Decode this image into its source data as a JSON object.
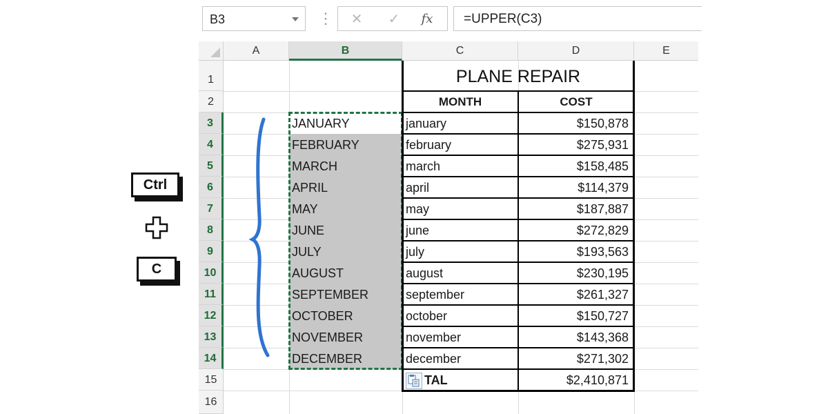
{
  "formula_bar": {
    "name_box": "B3",
    "fx_label": "fx",
    "cancel_icon": "x-icon",
    "enter_icon": "check-icon",
    "formula": "=UPPER(C3)"
  },
  "columns": [
    "A",
    "B",
    "C",
    "D",
    "E"
  ],
  "selected_column": "B",
  "rows": [
    "1",
    "2",
    "3",
    "4",
    "5",
    "6",
    "7",
    "8",
    "9",
    "10",
    "11",
    "12",
    "13",
    "14",
    "15",
    "16"
  ],
  "table": {
    "title": "PLANE REPAIR",
    "header_month": "MONTH",
    "header_cost": "COST",
    "upper_months": [
      "JANUARY",
      "FEBRUARY",
      "MARCH",
      "APRIL",
      "MAY",
      "JUNE",
      "JULY",
      "AUGUST",
      "SEPTEMBER",
      "OCTOBER",
      "NOVEMBER",
      "DECEMBER"
    ],
    "months": [
      "january",
      "february",
      "march",
      "april",
      "may",
      "june",
      "july",
      "august",
      "september",
      "october",
      "november",
      "december"
    ],
    "costs": [
      "$150,878",
      "$275,931",
      "$158,485",
      "$114,379",
      "$187,887",
      "$272,829",
      "$193,563",
      "$230,195",
      "$261,327",
      "$150,727",
      "$143,368",
      "$271,302"
    ],
    "total_label": "TAL",
    "total_value": "$2,410,871"
  },
  "keys": {
    "ctrl": "Ctrl",
    "plus": "+",
    "c": "C"
  },
  "colors": {
    "selection_green": "#217346",
    "brace_blue": "#2f74d0",
    "selection_gray": "#c7c7c7"
  }
}
